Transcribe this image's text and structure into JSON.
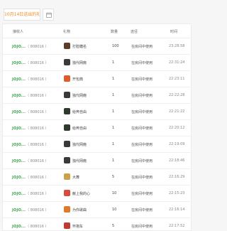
{
  "toolbar": {
    "date_label": "10月14日送出的礼物",
    "calendar_icon": "calendar-icon"
  },
  "table": {
    "columns": [
      "接收人",
      "礼物",
      "数量",
      "途径",
      "时间"
    ],
    "rows": [
      {
        "nick": "JOJO...",
        "uid": "（ 808016 ）",
        "gift": "打脸糖名",
        "gift_color": "#5a3e2b",
        "qty": "100",
        "source": "在房间中使用",
        "time": "23:28:58"
      },
      {
        "nick": "JOJO...",
        "uid": "（ 808016 ）",
        "gift": "独代网瘾",
        "gift_color": "#3a3a3a",
        "qty": "1",
        "source": "在房间中使用",
        "time": "22:31:24"
      },
      {
        "nick": "JOJO...",
        "uid": "（ 808016 ）",
        "gift": "开包典",
        "gift_color": "#e05a2a",
        "qty": "1",
        "source": "在房间中使用",
        "time": "22:23:11"
      },
      {
        "nick": "JOJO...",
        "uid": "（ 808016 ）",
        "gift": "独代网瘾",
        "gift_color": "#3a3a3a",
        "qty": "1",
        "source": "在房间中使用",
        "time": "22:22:28"
      },
      {
        "nick": "JOJO...",
        "uid": "（ 808016 ）",
        "gift": "给奔自由",
        "gift_color": "#2e3b2c",
        "qty": "1",
        "source": "在房间中使用",
        "time": "22:21:22"
      },
      {
        "nick": "JOJO...",
        "uid": "（ 808016 ）",
        "gift": "给奔自由",
        "gift_color": "#2e3b2c",
        "qty": "1",
        "source": "在房间中使用",
        "time": "22:20:12"
      },
      {
        "nick": "JOJO...",
        "uid": "（ 808016 ）",
        "gift": "独代网瘾",
        "gift_color": "#3a3a3a",
        "qty": "1",
        "source": "在房间中使用",
        "time": "22:19:09"
      },
      {
        "nick": "JOJO...",
        "uid": "（ 808016 ）",
        "gift": "独代网瘾",
        "gift_color": "#3a3a3a",
        "qty": "1",
        "source": "在房间中使用",
        "time": "22:18:46"
      },
      {
        "nick": "JOJO...",
        "uid": "（ 808016 ）",
        "gift": "大舞",
        "gift_color": "#c9a24a",
        "qty": "5",
        "source": "在房间中使用",
        "time": "22:16:29"
      },
      {
        "nick": "JOJO...",
        "uid": "（ 808016 ）",
        "gift": "献上我的心",
        "gift_color": "#d94b3a",
        "qty": "10",
        "source": "在房间中使用",
        "time": "22:15:23"
      },
      {
        "nick": "JOJO...",
        "uid": "（ 808016 ）",
        "gift": "为你歌曲",
        "gift_color": "#e07a2a",
        "qty": "10",
        "source": "在房间中使用",
        "time": "22:16:14"
      },
      {
        "nick": "JOJO...",
        "uid": "（ 808016 ）",
        "gift": "怀抱车",
        "gift_color": "#c23b30",
        "qty": "5",
        "source": "在房间中使用",
        "time": "22:17:52"
      }
    ]
  }
}
